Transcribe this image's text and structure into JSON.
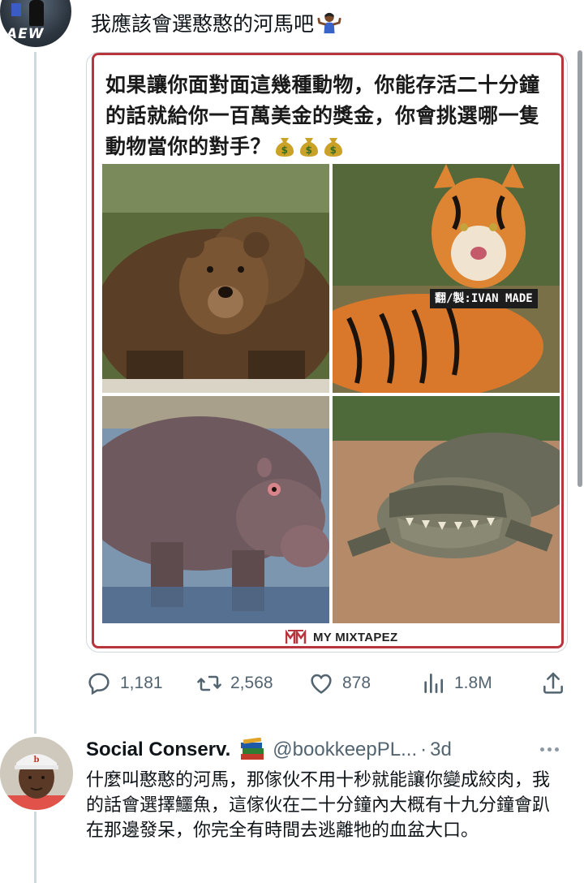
{
  "main_tweet": {
    "text": "我應該會選憨憨的河馬吧",
    "emoji": "person-shrugging-emoji"
  },
  "card": {
    "heading": "如果讓你面對面這幾種動物，你能存活二十分鐘的話就給你一百萬美金的獎金，你會挑選哪一隻動物當你的對手？",
    "heading_emoji": "money-bag-emoji",
    "credit": "翻/製:IVAN MADE",
    "footer_logo_text": "MY MIXTAPEZ",
    "accent_color": "#b8353e",
    "photos": [
      "bear",
      "tiger",
      "hippo",
      "crocodile"
    ]
  },
  "actions": {
    "replies": "1,181",
    "retweets": "2,568",
    "likes": "878",
    "views": "1.8M"
  },
  "reply": {
    "name": "Social Conserv.",
    "handle": "@bookkeepPL...",
    "separator": "·",
    "time": "3d",
    "body": "什麼叫憨憨的河馬，那傢伙不用十秒就能讓你變成絞肉，我的話會選擇鱷魚，這傢伙在二十分鐘內大概有十九分鐘會趴在那邊發呆，你完全有時間去逃離牠的血盆大口。"
  }
}
